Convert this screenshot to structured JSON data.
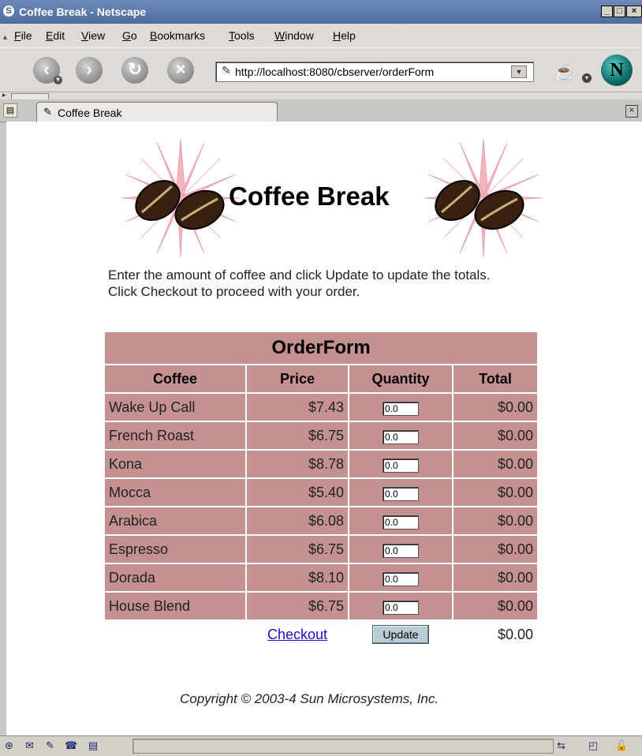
{
  "window": {
    "title": "Coffee Break - Netscape"
  },
  "menu": [
    {
      "mnemonic": "F",
      "rest": "ile"
    },
    {
      "mnemonic": "E",
      "rest": "dit"
    },
    {
      "mnemonic": "V",
      "rest": "iew"
    },
    {
      "mnemonic": "G",
      "rest": "o"
    },
    {
      "mnemonic": "B",
      "rest": "ookmarks"
    },
    {
      "mnemonic": "T",
      "rest": "ools"
    },
    {
      "mnemonic": "W",
      "rest": "indow"
    },
    {
      "mnemonic": "H",
      "rest": "elp"
    }
  ],
  "navbar": {
    "url": "http://localhost:8080/cbserver/orderForm",
    "brand_letter": "N"
  },
  "tab": {
    "label": "Coffee Break"
  },
  "page": {
    "heading": "Coffee Break",
    "intro_line1": "Enter the amount of coffee and click Update to update the totals.",
    "intro_line2": "Click Checkout to proceed with your order.",
    "copyright": "Copyright © 2003-4 Sun Microsystems, Inc."
  },
  "order_form": {
    "caption": "OrderForm",
    "headers": [
      "Coffee",
      "Price",
      "Quantity",
      "Total"
    ],
    "rows": [
      {
        "coffee": "Wake Up Call",
        "price": "$7.43",
        "quantity": "0.0",
        "total": "$0.00"
      },
      {
        "coffee": "French Roast",
        "price": "$6.75",
        "quantity": "0.0",
        "total": "$0.00"
      },
      {
        "coffee": "Kona",
        "price": "$8.78",
        "quantity": "0.0",
        "total": "$0.00"
      },
      {
        "coffee": "Mocca",
        "price": "$5.40",
        "quantity": "0.0",
        "total": "$0.00"
      },
      {
        "coffee": "Arabica",
        "price": "$6.08",
        "quantity": "0.0",
        "total": "$0.00"
      },
      {
        "coffee": "Espresso",
        "price": "$6.75",
        "quantity": "0.0",
        "total": "$0.00"
      },
      {
        "coffee": "Dorada",
        "price": "$8.10",
        "quantity": "0.0",
        "total": "$0.00"
      },
      {
        "coffee": "House Blend",
        "price": "$6.75",
        "quantity": "0.0",
        "total": "$0.00"
      }
    ],
    "checkout_label": "Checkout",
    "update_label": "Update",
    "grand_total": "$0.00"
  },
  "colors": {
    "table_bg": "#c49090",
    "link": "#1a0dcc",
    "titlebar": "#4d6c9e"
  }
}
